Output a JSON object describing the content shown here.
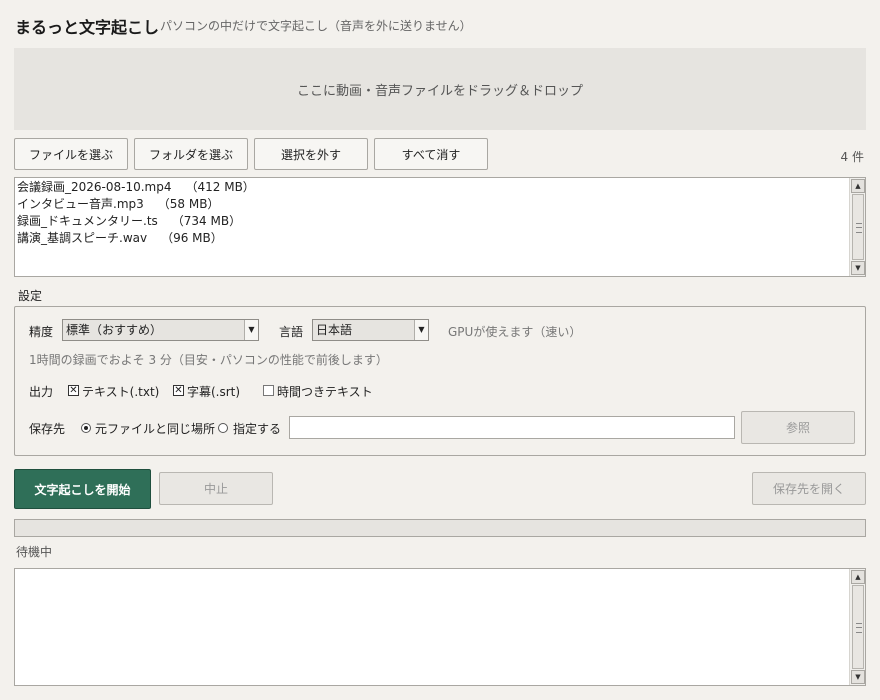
{
  "app": {
    "title": "まるっと文字起こし",
    "subtitle": "パソコンの中だけで文字起こし（音声を外に送りません）"
  },
  "dropzone": {
    "text": "ここに動画・音声ファイルをドラッグ＆ドロップ"
  },
  "toolbar": {
    "choose_files": "ファイルを選ぶ",
    "choose_folder": "フォルダを選ぶ",
    "deselect": "選択を外す",
    "clear_all": "すべて消す",
    "count": "4 件"
  },
  "files": [
    {
      "name": "会議録画_2026-08-10.mp4",
      "size": "（412 MB）"
    },
    {
      "name": "インタビュー音声.mp3",
      "size": "（58 MB）"
    },
    {
      "name": "録画_ドキュメンタリー.ts",
      "size": "（734 MB）"
    },
    {
      "name": "講演_基調スピーチ.wav",
      "size": "（96 MB）"
    }
  ],
  "settings": {
    "section_label": "設定",
    "accuracy_label": "精度",
    "accuracy_value": "標準（おすすめ）",
    "language_label": "言語",
    "language_value": "日本語",
    "gpu_status": "GPUが使えます（速い）",
    "estimate": "1時間の録画でおよそ 3 分（目安・パソコンの性能で前後します）",
    "output_label": "出力",
    "outputs": [
      {
        "label": "テキスト(.txt)",
        "checked": true
      },
      {
        "label": "字幕(.srt)",
        "checked": true
      },
      {
        "label": "時間つきテキスト",
        "checked": false
      }
    ],
    "save_label": "保存先",
    "save_options": [
      {
        "label": "元ファイルと同じ場所",
        "selected": true
      },
      {
        "label": "指定する",
        "selected": false
      }
    ],
    "save_path": "",
    "browse": "参照"
  },
  "actions": {
    "start": "文字起こしを開始",
    "stop": "中止",
    "open_folder": "保存先を開く"
  },
  "progress": {
    "value": 0,
    "status": "待機中"
  },
  "colors": {
    "primary": "#2f6f58",
    "background": "#f3f1ed"
  },
  "icons": {
    "scroll_up": "▲",
    "scroll_down": "▼",
    "dropdown": "▼",
    "check": "✕"
  }
}
